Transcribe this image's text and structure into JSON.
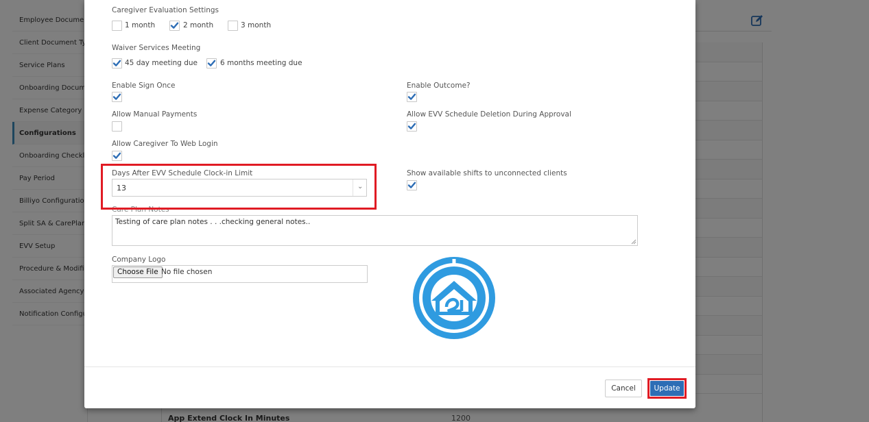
{
  "sidebar": {
    "items": [
      {
        "label": "Employee Documents"
      },
      {
        "label": "Client Document Types"
      },
      {
        "label": "Service Plans"
      },
      {
        "label": "Onboarding Documents"
      },
      {
        "label": "Expense Category"
      },
      {
        "label": "Configurations"
      },
      {
        "label": "Onboarding Checklist"
      },
      {
        "label": "Pay Period"
      },
      {
        "label": "Billiyo Configuration"
      },
      {
        "label": "Split SA & CarePlan"
      },
      {
        "label": "EVV Setup"
      },
      {
        "label": "Procedure & Modifiers"
      },
      {
        "label": "Associated Agency"
      },
      {
        "label": "Notification Configuration"
      }
    ],
    "active_index": 5
  },
  "background": {
    "last_row_label": "App Extend Clock In Minutes",
    "last_row_value": "1200"
  },
  "modal": {
    "caregiver_eval": {
      "label": "Caregiver Evaluation Settings",
      "options": [
        {
          "label": "1 month",
          "checked": false
        },
        {
          "label": "2 month",
          "checked": true
        },
        {
          "label": "3 month",
          "checked": false
        }
      ]
    },
    "waiver": {
      "label": "Waiver Services Meeting",
      "options": [
        {
          "label": "45 day meeting due",
          "checked": true
        },
        {
          "label": "6 months meeting due",
          "checked": true
        }
      ]
    },
    "enable_sign_once": {
      "label": "Enable Sign Once",
      "checked": true
    },
    "enable_outcome": {
      "label": "Enable Outcome?",
      "checked": true
    },
    "allow_manual_payments": {
      "label": "Allow Manual Payments",
      "checked": false
    },
    "allow_evv_deletion": {
      "label": "Allow EVV Schedule Deletion During Approval",
      "checked": true
    },
    "allow_web_login": {
      "label": "Allow Caregiver To Web Login",
      "checked": true
    },
    "clockin_limit": {
      "label": "Days After EVV Schedule Clock-in Limit",
      "value": "13"
    },
    "show_shifts": {
      "label": "Show available shifts to unconnected clients",
      "checked": true
    },
    "care_plan_notes": {
      "label": "Care Plan Notes",
      "value": "Testing of care plan notes . . .checking general notes.."
    },
    "company_logo": {
      "label": "Company Logo",
      "button": "Choose File",
      "status": "No file chosen"
    },
    "footer": {
      "cancel": "Cancel",
      "update": "Update"
    }
  },
  "colors": {
    "accent": "#2d6db5",
    "highlight": "#e01b24",
    "logo_blue": "#2f9be0"
  }
}
